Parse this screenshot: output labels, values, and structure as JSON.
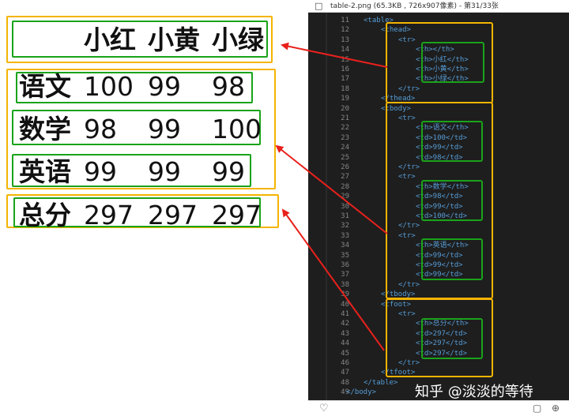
{
  "viewer": {
    "title": "table-2.png (65.3KB , 726x907像素) - 第31/33张"
  },
  "table": {
    "header": [
      "小红",
      "小黄",
      "小绿"
    ],
    "rows": [
      {
        "label": "语文",
        "values": [
          "100",
          "99",
          "98"
        ]
      },
      {
        "label": "数学",
        "values": [
          "98",
          "99",
          "100"
        ]
      },
      {
        "label": "英语",
        "values": [
          "99",
          "99",
          "99"
        ]
      }
    ],
    "footer": {
      "label": "总分",
      "values": [
        "297",
        "297",
        "297"
      ]
    }
  },
  "code": {
    "lines": [
      {
        "n": "11",
        "t": "<table>"
      },
      {
        "n": "12",
        "t": "<thead>"
      },
      {
        "n": "13",
        "t": "<tr>"
      },
      {
        "n": "14",
        "t": "<th></th>"
      },
      {
        "n": "15",
        "t": "<th>小红</th>"
      },
      {
        "n": "16",
        "t": "<th>小黄</th>"
      },
      {
        "n": "17",
        "t": "<th>小绿</th>"
      },
      {
        "n": "18",
        "t": "</tr>"
      },
      {
        "n": "19",
        "t": "</thead>"
      },
      {
        "n": "20",
        "t": "<tbody>"
      },
      {
        "n": "21",
        "t": "<tr>"
      },
      {
        "n": "22",
        "t": "<th>语文</th>"
      },
      {
        "n": "23",
        "t": "<td>100</td>"
      },
      {
        "n": "24",
        "t": "<td>99</td>"
      },
      {
        "n": "25",
        "t": "<td>98</td>"
      },
      {
        "n": "26",
        "t": "</tr>"
      },
      {
        "n": "27",
        "t": "<tr>"
      },
      {
        "n": "28",
        "t": "<th>数学</th>"
      },
      {
        "n": "29",
        "t": "<td>98</td>"
      },
      {
        "n": "30",
        "t": "<td>99</td>"
      },
      {
        "n": "31",
        "t": "<td>100</td>"
      },
      {
        "n": "32",
        "t": "</tr>"
      },
      {
        "n": "33",
        "t": "<tr>"
      },
      {
        "n": "34",
        "t": "<th>英语</th>"
      },
      {
        "n": "35",
        "t": "<td>99</td>"
      },
      {
        "n": "36",
        "t": "<td>99</td>"
      },
      {
        "n": "37",
        "t": "<td>99</td>"
      },
      {
        "n": "38",
        "t": "</tr>"
      },
      {
        "n": "39",
        "t": "</tbody>"
      },
      {
        "n": "40",
        "t": "<tfoot>"
      },
      {
        "n": "41",
        "t": "<tr>"
      },
      {
        "n": "42",
        "t": "<th>总分</th>"
      },
      {
        "n": "43",
        "t": "<td>297</td>"
      },
      {
        "n": "44",
        "t": "<td>297</td>"
      },
      {
        "n": "45",
        "t": "<td>297</td>"
      },
      {
        "n": "46",
        "t": "</tr>"
      },
      {
        "n": "47",
        "t": "</tfoot>"
      },
      {
        "n": "48",
        "t": "</table>"
      },
      {
        "n": "49",
        "t": "</body>"
      }
    ]
  },
  "watermark": "知乎 @淡淡的等待",
  "icons": {
    "viewer": "image-viewer-icon",
    "like": "heart-icon",
    "fit": "fit-screen-icon",
    "zoom": "zoom-in-icon"
  },
  "colors": {
    "outer_box": "#f4b400",
    "inner_box": "#1aa31a",
    "arrow": "#e8211c",
    "tag": "#569cd6"
  }
}
